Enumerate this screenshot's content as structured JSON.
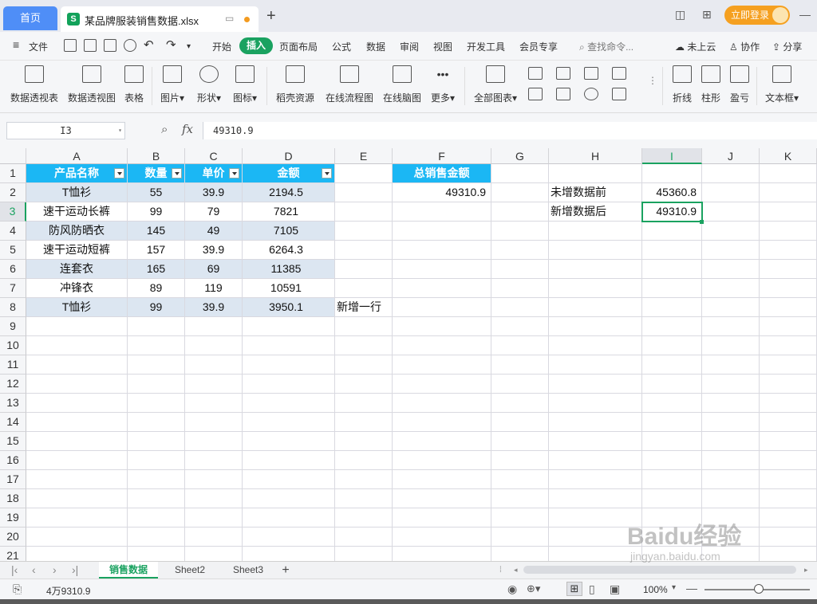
{
  "titlebar": {
    "home_tab": "首页",
    "doc_title": "某品牌服装销售数据.xlsx",
    "login": "立即登录"
  },
  "menu": {
    "file": "文件",
    "items": [
      "开始",
      "插入",
      "页面布局",
      "公式",
      "数据",
      "审阅",
      "视图",
      "开发工具",
      "会员专享"
    ],
    "search": "查找命令...",
    "cloud": "未上云",
    "collab": "协作",
    "share": "分享"
  },
  "ribbon": {
    "items": [
      "数据透视表",
      "数据透视图",
      "表格",
      "图片",
      "形状",
      "图标",
      "稻壳资源",
      "在线流程图",
      "在线脑图",
      "更多",
      "全部图表",
      "折线",
      "柱形",
      "盈亏",
      "文本框"
    ]
  },
  "formula_bar": {
    "cell_ref": "I3",
    "fx": "fx",
    "value": "49310.9"
  },
  "grid": {
    "columns": [
      "A",
      "B",
      "C",
      "D",
      "E",
      "F",
      "G",
      "H",
      "I",
      "J",
      "K"
    ],
    "rows": [
      "1",
      "2",
      "3",
      "4",
      "5",
      "6",
      "7",
      "8",
      "9",
      "10",
      "11",
      "12",
      "13",
      "14",
      "15",
      "16",
      "17",
      "18",
      "19",
      "20",
      "21"
    ],
    "table_headers": [
      "产品名称",
      "数量",
      "单价",
      "金额"
    ],
    "table_rows": [
      [
        "T恤衫",
        "55",
        "39.9",
        "2194.5"
      ],
      [
        "速干运动长裤",
        "99",
        "79",
        "7821"
      ],
      [
        "防风防晒衣",
        "145",
        "49",
        "7105"
      ],
      [
        "速干运动短裤",
        "157",
        "39.9",
        "6264.3"
      ],
      [
        "连套衣",
        "165",
        "69",
        "11385"
      ],
      [
        "冲锋衣",
        "89",
        "119",
        "10591"
      ],
      [
        "T恤衫",
        "99",
        "39.9",
        "3950.1"
      ]
    ],
    "e8": "新增一行",
    "f1": "总销售金额",
    "f2": "49310.9",
    "h2": "未增数据前",
    "i2": "45360.8",
    "h3": "新增数据后",
    "i3": "49310.9"
  },
  "sheets": [
    "销售数据",
    "Sheet2",
    "Sheet3"
  ],
  "status": {
    "sum": "4万9310.9",
    "zoom": "100%"
  },
  "watermark": {
    "main": "Baidu经验",
    "sub": "jingyan.baidu.com"
  }
}
